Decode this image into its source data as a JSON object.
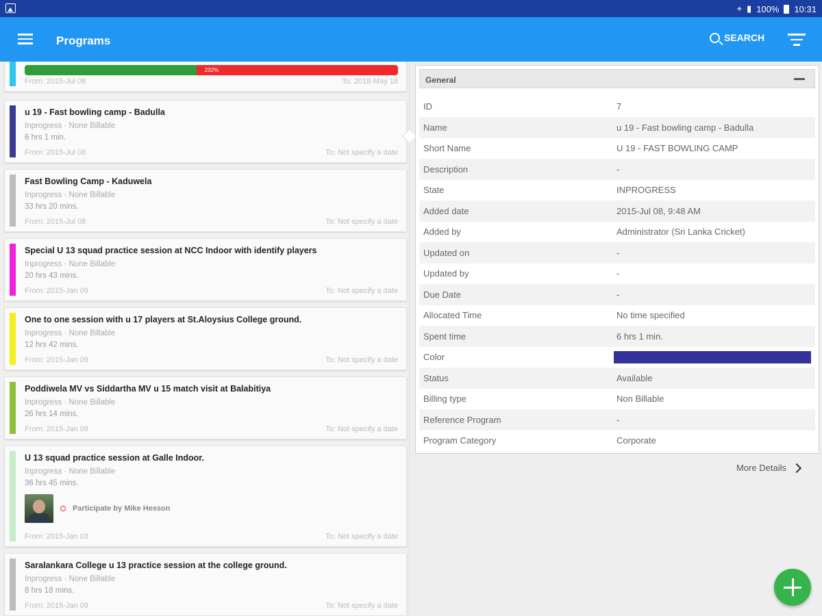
{
  "status_bar": {
    "battery": "100%",
    "time": "10:31"
  },
  "app_bar": {
    "title": "Programs",
    "search_label": "SEARCH"
  },
  "list": {
    "top_card": {
      "progress_label": "232%",
      "progress_fraction": 0.46,
      "stripe_color": "#33c4ec",
      "from": "From: 2015-Jul 08",
      "to": "To: 2018-May 18"
    },
    "items": [
      {
        "title": "u 19 - Fast bowling camp - Badulla",
        "meta": "Inprogress  ·  None Billable",
        "duration": "6 hrs 1 min.",
        "from": "From: 2015-Jul 08",
        "to": "To: Not specify a date",
        "color": "#3a3a94"
      },
      {
        "title": "Fast Bowling Camp - Kaduwela",
        "meta": "Inprogress  ·  None Billable",
        "duration": "33 hrs 20 mins.",
        "from": "From: 2015-Jul 08",
        "to": "To: Not specify a date",
        "color": "#bdbdbd"
      },
      {
        "title": "Special  U 13 squad practice session at NCC Indoor with identify players",
        "meta": "Inprogress  ·  None Billable",
        "duration": "20 hrs 43 mins.",
        "from": "From: 2015-Jan 09",
        "to": "To: Not specify a date",
        "color": "#ee22dd"
      },
      {
        "title": "One to one session with u 17 players at St.Aloysius College ground.",
        "meta": "Inprogress  ·  None Billable",
        "duration": "12 hrs 42 mins.",
        "from": "From: 2015-Jan 09",
        "to": "To: Not specify a date",
        "color": "#f2ee22"
      },
      {
        "title": "Poddiwela MV vs Siddartha MV u 15 match visit at Balabitiya",
        "meta": "Inprogress  ·  None Billable",
        "duration": "26 hrs 14 mins.",
        "from": "From: 2015-Jan 09",
        "to": "To: Not specify a date",
        "color": "#8dc03c"
      },
      {
        "title": "U 13 squad practice session at Galle Indoor.",
        "meta": "Inprogress  ·  None Billable",
        "duration": "36 hrs 45 mins.",
        "from": "From: 2015-Jan 03",
        "to": "To: Not specify a date",
        "color": "#c8edc8",
        "participant": "Participate by Mike Hesson"
      },
      {
        "title": "Saralankara College u 13 practice session at the college ground.",
        "meta": "Inprogress  ·  None Billable",
        "duration": "8 hrs 18 mins.",
        "from": "From: 2015-Jan 09",
        "to": "To: Not specify a date",
        "color": "#bdbdbd"
      }
    ]
  },
  "detail": {
    "section_title": "General",
    "color_value": "#32329a",
    "rows": [
      {
        "key": "ID",
        "value": "7"
      },
      {
        "key": "Name",
        "value": "u 19 - Fast bowling camp - Badulla"
      },
      {
        "key": "Short Name",
        "value": "U 19 - FAST BOWLING CAMP"
      },
      {
        "key": "Description",
        "value": "-"
      },
      {
        "key": "State",
        "value": "INPROGRESS"
      },
      {
        "key": "Added date",
        "value": "2015-Jul 08, 9:48 AM"
      },
      {
        "key": "Added by",
        "value": "Administrator (Sri Lanka Cricket)"
      },
      {
        "key": "Updated on",
        "value": "-"
      },
      {
        "key": "Updated by",
        "value": "-"
      },
      {
        "key": "Due Date",
        "value": "-"
      },
      {
        "key": "Allocated Time",
        "value": "No time specified"
      },
      {
        "key": "Spent time",
        "value": "6 hrs 1 min."
      },
      {
        "key": "Color",
        "value": ""
      },
      {
        "key": "Status",
        "value": "Available"
      },
      {
        "key": "Billing type",
        "value": "Non Billable"
      },
      {
        "key": "Reference Program",
        "value": "-"
      },
      {
        "key": "Program Category",
        "value": "Corporate"
      }
    ],
    "more_details": "More Details"
  }
}
